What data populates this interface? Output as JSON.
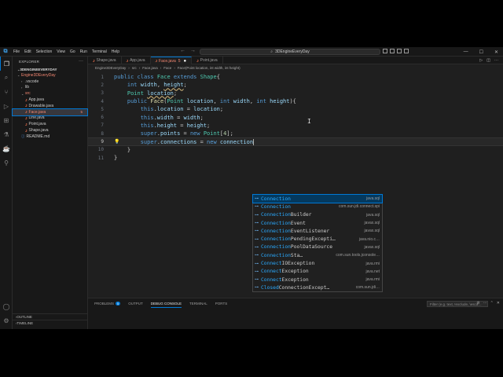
{
  "titlebar": {
    "logo": "⧉",
    "menus": [
      "File",
      "Edit",
      "Selection",
      "View",
      "Go",
      "Run",
      "Terminal",
      "Help"
    ],
    "search": "3DEngineEveryDay",
    "back_arrow": "←",
    "fwd_arrow": "→"
  },
  "sidebar": {
    "title": "EXPLORER",
    "project": "3DENGINEEVERYDAY",
    "tree": [
      {
        "label": "Engine3DEveryDay",
        "kind": "folder-open",
        "indent": 0,
        "cls": "err-file"
      },
      {
        "label": ".vscode",
        "kind": "folder",
        "indent": 1,
        "cls": ""
      },
      {
        "label": "lib",
        "kind": "folder",
        "indent": 1,
        "cls": ""
      },
      {
        "label": "src",
        "kind": "folder-open",
        "indent": 1,
        "cls": "err-file"
      },
      {
        "label": "App.java",
        "kind": "java",
        "indent": 2,
        "cls": ""
      },
      {
        "label": "Drawable.java",
        "kind": "java",
        "indent": 2,
        "cls": ""
      },
      {
        "label": "Face.java",
        "kind": "java",
        "indent": 2,
        "cls": "err-file",
        "badge": "5",
        "selected": true
      },
      {
        "label": "Line.java",
        "kind": "java",
        "indent": 2,
        "cls": ""
      },
      {
        "label": "Point.java",
        "kind": "java",
        "indent": 2,
        "cls": ""
      },
      {
        "label": "Shape.java",
        "kind": "java",
        "indent": 2,
        "cls": ""
      },
      {
        "label": "README.md",
        "kind": "info",
        "indent": 1,
        "cls": ""
      }
    ],
    "outline": "OUTLINE",
    "timeline": "TIMELINE"
  },
  "tabs": [
    {
      "label": "Shape.java",
      "active": false
    },
    {
      "label": "App.java",
      "active": false
    },
    {
      "label": "Face.java",
      "active": true,
      "modified": "●",
      "badge": "5"
    },
    {
      "label": "Point.java",
      "active": false
    }
  ],
  "breadcrumb": [
    "Engine3DEveryDay",
    "src",
    "Face.java",
    "Face",
    "Face(Point location, int width, int height)"
  ],
  "editor": {
    "line_numbers": [
      "1",
      "2",
      "3",
      "4",
      "5",
      "6",
      "7",
      "8",
      "9",
      "10",
      "11"
    ],
    "current_line": 9
  },
  "suggest": [
    {
      "match": "Connection",
      "rest": "",
      "detail": "java.sql"
    },
    {
      "match": "Connection",
      "rest": "",
      "detail": "com.sun.jdi.connect.spi"
    },
    {
      "match": "Connection",
      "rest": "Builder",
      "detail": "java.sql"
    },
    {
      "match": "Connection",
      "rest": "Event",
      "detail": "javax.sql"
    },
    {
      "match": "Connection",
      "rest": "EventListener",
      "detail": "javax.sql"
    },
    {
      "match": "Connection",
      "rest": "PendingExcepti…",
      "detail": "java.nio.c…"
    },
    {
      "match": "Connection",
      "rest": "PoolDataSource",
      "detail": "javax.sql"
    },
    {
      "match": "Connection",
      "rest": "Sta…",
      "detail": "com.sun.tools.jconsole…"
    },
    {
      "match": "Connect",
      "rest": "IOException",
      "detail": "java.rmi"
    },
    {
      "match": "Connect",
      "rest": "Exception",
      "detail": "java.net"
    },
    {
      "match": "Connect",
      "rest": "Exception",
      "detail": "java.rmi"
    },
    {
      "match": "Closed",
      "rest": "ConnectionExcept…",
      "detail": "com.sun.jdi…"
    }
  ],
  "panel": {
    "tabs": [
      "PROBLEMS",
      "OUTPUT",
      "DEBUG CONSOLE",
      "TERMINAL",
      "PORTS"
    ],
    "problems_badge": "5",
    "active": "DEBUG CONSOLE",
    "filter_placeholder": "Filter (e.g. text, !exclude, \\esca…"
  }
}
